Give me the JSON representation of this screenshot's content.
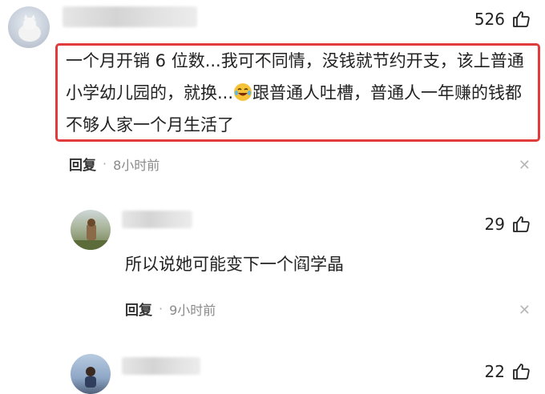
{
  "comments": [
    {
      "likes": "526",
      "text_part1": "一个月开销 6 位数...我可不同情，没钱就节约开支，该上普通小学幼儿园的，就换...",
      "emoji": "laugh-cry-emoji",
      "text_part2": "跟普通人吐槽，普通人一年赚的钱都不够人家一个月生活了",
      "reply_label": "回复",
      "time": "8小时前"
    },
    {
      "likes": "29",
      "text": "所以说她可能变下一个阎学晶",
      "reply_label": "回复",
      "time": "9小时前"
    },
    {
      "likes": "22"
    }
  ],
  "colors": {
    "highlight_border": "#e23b3b",
    "meta_gray": "#8a8a8a"
  },
  "icons": [
    "thumbs-up-icon",
    "close-icon"
  ]
}
